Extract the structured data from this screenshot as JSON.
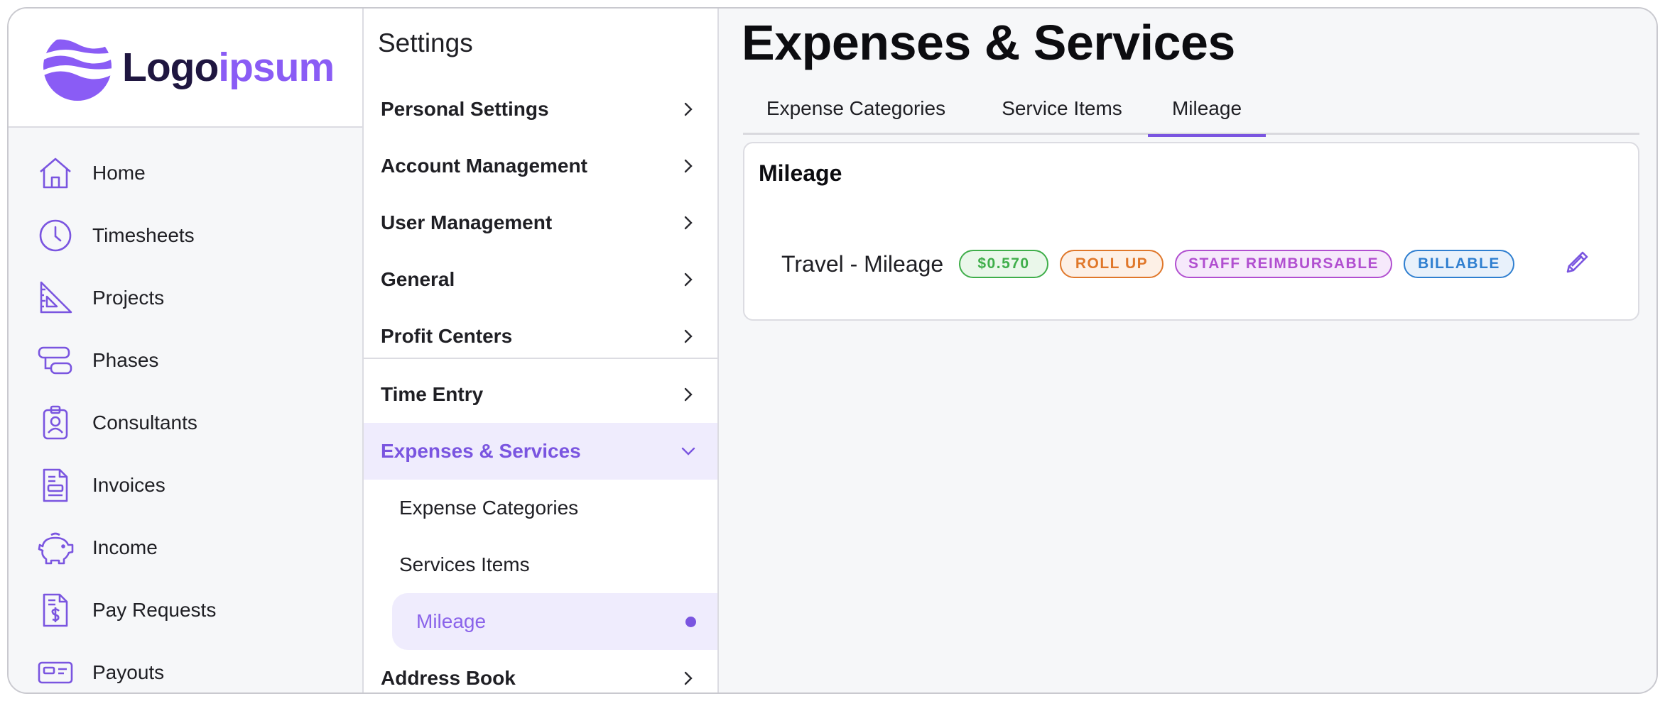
{
  "brand": {
    "name_primary": "Logo",
    "name_accent": "ipsum",
    "accent_color": "#8a5cf5"
  },
  "nav": {
    "items": [
      {
        "label": "Home",
        "icon": "home-icon"
      },
      {
        "label": "Timesheets",
        "icon": "clock-icon"
      },
      {
        "label": "Projects",
        "icon": "set-square-icon"
      },
      {
        "label": "Phases",
        "icon": "phases-icon"
      },
      {
        "label": "Consultants",
        "icon": "id-badge-icon"
      },
      {
        "label": "Invoices",
        "icon": "invoice-icon"
      },
      {
        "label": "Income",
        "icon": "piggy-bank-icon"
      },
      {
        "label": "Pay Requests",
        "icon": "dollar-document-icon"
      },
      {
        "label": "Payouts",
        "icon": "card-icon"
      }
    ]
  },
  "settings": {
    "title": "Settings",
    "items": [
      {
        "label": "Personal Settings"
      },
      {
        "label": "Account Management"
      },
      {
        "label": "User Management"
      },
      {
        "label": "General"
      },
      {
        "label": "Profit Centers"
      },
      {
        "label": "Time Entry"
      },
      {
        "label": "Expenses & Services",
        "expanded": true
      },
      {
        "label": "Address Book"
      }
    ],
    "sub_items": [
      {
        "label": "Expense Categories"
      },
      {
        "label": "Services Items"
      },
      {
        "label": "Mileage",
        "selected": true
      }
    ]
  },
  "main": {
    "title": "Expenses & Services",
    "tabs": [
      {
        "label": "Expense Categories"
      },
      {
        "label": "Service Items"
      },
      {
        "label": "Mileage",
        "active": true
      }
    ],
    "card": {
      "title": "Mileage",
      "row": {
        "label": "Travel - Mileage",
        "badges": [
          {
            "text": "$0.570",
            "color": "#3fae4a",
            "bg": "#eaf7ea"
          },
          {
            "text": "ROLL UP",
            "color": "#e0772a",
            "bg": "#fdf0e6"
          },
          {
            "text": "STAFF REIMBURSABLE",
            "color": "#b14fd0",
            "bg": "#f6e9fb"
          },
          {
            "text": "BILLABLE",
            "color": "#2f7fd0",
            "bg": "#e8f1fb"
          }
        ]
      }
    }
  }
}
